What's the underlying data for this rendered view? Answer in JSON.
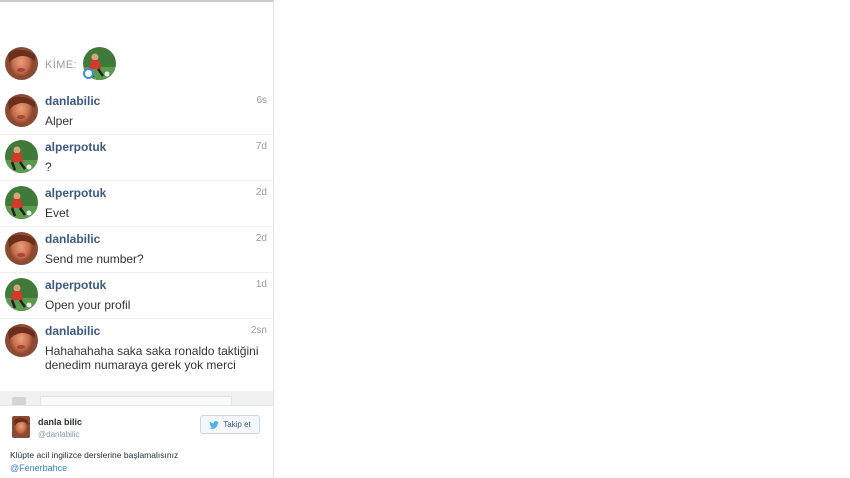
{
  "to_row": {
    "label": "KİME:"
  },
  "messages": [
    {
      "user": "danlabilic",
      "time": "6s",
      "text": "Alper",
      "avatar": "face-avatar"
    },
    {
      "user": "alperpotuk",
      "time": "7d",
      "text": "?",
      "avatar": "football-avatar"
    },
    {
      "user": "alperpotuk",
      "time": "2d",
      "text": "Evet",
      "avatar": "football-avatar"
    },
    {
      "user": "danlabilic",
      "time": "2d",
      "text": "Send me number?",
      "avatar": "face-avatar"
    },
    {
      "user": "alperpotuk",
      "time": "1d",
      "text": "Open your profil",
      "avatar": "football-avatar"
    },
    {
      "user": "danlabilic",
      "time": "2sn",
      "text": "Hahahahaha saka saka ronaldo taktiğini denedim numaraya gerek yok merci",
      "avatar": "face-avatar"
    }
  ],
  "tweet": {
    "name": "danla bilic",
    "handle": "@danlabilic",
    "follow_label": "Takip et",
    "text": "Klüpte acil ingilizce derslerine başlamalısınız",
    "mention": "@Fenerbahce"
  },
  "colors": {
    "username": "#3d5a7d",
    "timestamp": "#9a9a9a",
    "twitter_blue": "#55acee",
    "mention": "#3f7fbf"
  }
}
